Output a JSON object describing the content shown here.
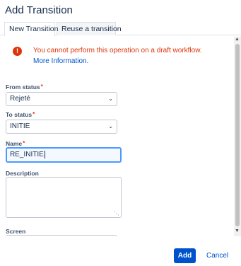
{
  "dialog": {
    "title": "Add Transition"
  },
  "tabs": [
    {
      "label": "New Transition",
      "active": true
    },
    {
      "label": "Reuse a transition",
      "active": false
    }
  ],
  "error": {
    "message": "You cannot perform this operation on a draft workflow.",
    "link": "More Information."
  },
  "form": {
    "from_status": {
      "label": "From status",
      "required": "*",
      "value": "Rejeté"
    },
    "to_status": {
      "label": "To status",
      "required": "*",
      "value": "INITIE"
    },
    "name": {
      "label": "Name",
      "required": "*",
      "value": "RE_INITIE"
    },
    "description": {
      "label": "Description",
      "value": ""
    },
    "screen": {
      "label": "Screen"
    }
  },
  "footer": {
    "add_label": "Add",
    "cancel_label": "Cancel"
  },
  "colors": {
    "primary": "#0052cc",
    "error": "#de350b",
    "focus": "#4c9aff"
  }
}
